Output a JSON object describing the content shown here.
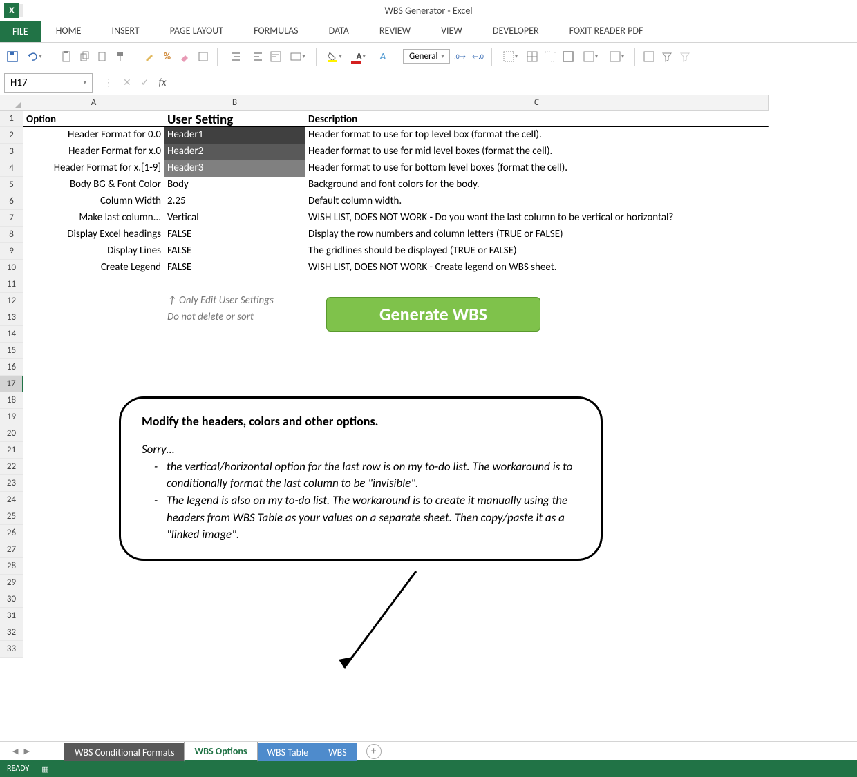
{
  "window": {
    "title": "WBS Generator - Excel"
  },
  "tabs": {
    "file": "FILE",
    "home": "HOME",
    "insert": "INSERT",
    "pageLayout": "PAGE LAYOUT",
    "formulas": "FORMULAS",
    "data": "DATA",
    "review": "REVIEW",
    "view": "VIEW",
    "developer": "DEVELOPER",
    "foxit": "FOXIT READER PDF"
  },
  "nameBox": "H17",
  "numberFormat": "General",
  "columns": {
    "a": "A",
    "b": "B",
    "c": "C"
  },
  "headerRow": {
    "option": "Option",
    "userSetting": "User Setting",
    "description": "Description"
  },
  "rows": [
    {
      "opt": "Header Format for 0.0",
      "val": "Header1",
      "desc": "Header format to use for top level box (format the cell).",
      "cls": "hdr1"
    },
    {
      "opt": "Header Format for x.0",
      "val": "Header2",
      "desc": "Header format to use for mid level boxes (format the cell).",
      "cls": "hdr2"
    },
    {
      "opt": "Header Format for x.[1-9]",
      "val": "Header3",
      "desc": "Header format to use for bottom level boxes (format the cell).",
      "cls": "hdr3"
    },
    {
      "opt": "Body BG & Font Color",
      "val": "Body",
      "desc": "Background and font colors for the body.",
      "cls": ""
    },
    {
      "opt": "Column Width",
      "val": "2.25",
      "desc": "Default column width.",
      "cls": ""
    },
    {
      "opt": "Make last column...",
      "val": "Vertical",
      "desc": "WISH LIST, DOES NOT WORK - Do you want the last column to be vertical or horizontal?",
      "cls": ""
    },
    {
      "opt": "Display Excel headings",
      "val": "FALSE",
      "desc": "Display the row numbers and column letters (TRUE or FALSE)",
      "cls": ""
    },
    {
      "opt": "Display Lines",
      "val": "FALSE",
      "desc": "The gridlines should be displayed (TRUE or FALSE)",
      "cls": ""
    },
    {
      "opt": "Create Legend",
      "val": "FALSE",
      "desc": "WISH LIST, DOES NOT WORK - Create legend on WBS sheet.",
      "cls": ""
    }
  ],
  "hint": {
    "line1": "↑  Only Edit User Settings",
    "line2": "Do not delete or sort"
  },
  "generateBtn": "Generate WBS",
  "callout": {
    "title": "Modify the headers, colors and other options.",
    "sorry": "Sorry…",
    "b1": "the vertical/horizontal option for the last row is on my to-do list. The workaround is to conditionally format the last column to be \"invisible\".",
    "b2": "The legend is also on my to-do list. The workaround is to create it manually using the headers from WBS Table as your values on a separate sheet. Then copy/paste it as a \"linked image\"."
  },
  "sheetTabs": {
    "t1": "WBS Conditional Formats",
    "t2": "WBS Options",
    "t3": "WBS Table",
    "t4": "WBS"
  },
  "status": "READY"
}
